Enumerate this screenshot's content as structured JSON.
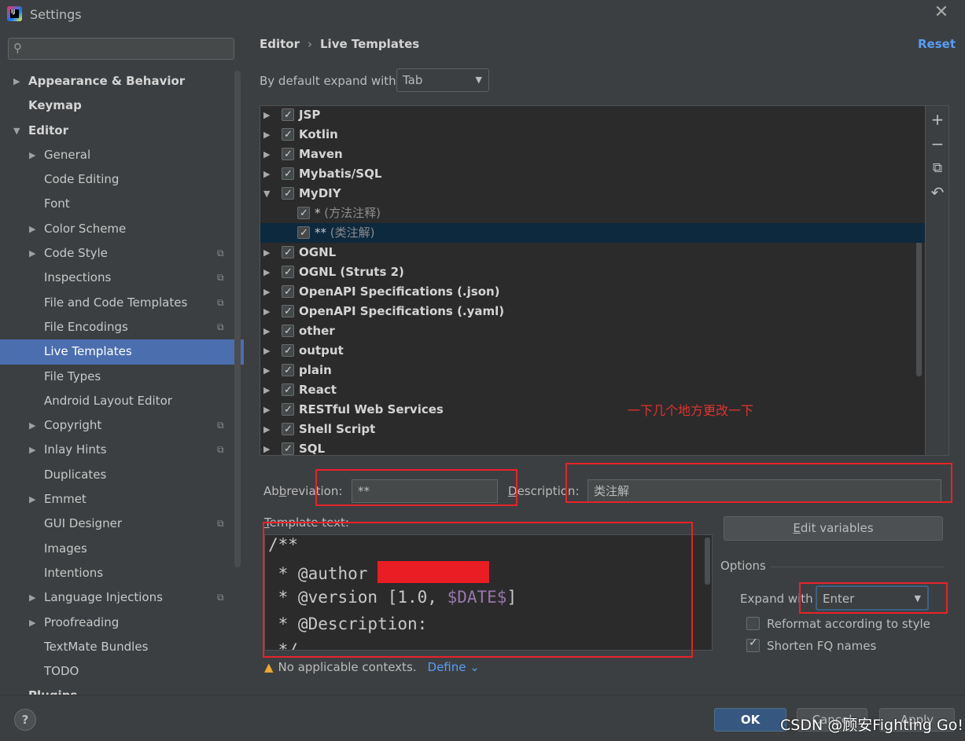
{
  "window": {
    "title": "Settings"
  },
  "search": {
    "placeholder": ""
  },
  "sidebar": {
    "items": [
      {
        "label": "Appearance & Behavior",
        "level": 0,
        "arrow": "▶",
        "copy": false
      },
      {
        "label": "Keymap",
        "level": 0,
        "arrow": "",
        "copy": false
      },
      {
        "label": "Editor",
        "level": 0,
        "arrow": "▼",
        "copy": false
      },
      {
        "label": "General",
        "level": 1,
        "arrow": "▶",
        "copy": false
      },
      {
        "label": "Code Editing",
        "level": 1,
        "arrow": "",
        "copy": false
      },
      {
        "label": "Font",
        "level": 1,
        "arrow": "",
        "copy": false
      },
      {
        "label": "Color Scheme",
        "level": 1,
        "arrow": "▶",
        "copy": false
      },
      {
        "label": "Code Style",
        "level": 1,
        "arrow": "▶",
        "copy": true
      },
      {
        "label": "Inspections",
        "level": 1,
        "arrow": "",
        "copy": true
      },
      {
        "label": "File and Code Templates",
        "level": 1,
        "arrow": "",
        "copy": true
      },
      {
        "label": "File Encodings",
        "level": 1,
        "arrow": "",
        "copy": true
      },
      {
        "label": "Live Templates",
        "level": 1,
        "arrow": "",
        "copy": false,
        "selected": true
      },
      {
        "label": "File Types",
        "level": 1,
        "arrow": "",
        "copy": false
      },
      {
        "label": "Android Layout Editor",
        "level": 1,
        "arrow": "",
        "copy": false
      },
      {
        "label": "Copyright",
        "level": 1,
        "arrow": "▶",
        "copy": true
      },
      {
        "label": "Inlay Hints",
        "level": 1,
        "arrow": "▶",
        "copy": true
      },
      {
        "label": "Duplicates",
        "level": 1,
        "arrow": "",
        "copy": false
      },
      {
        "label": "Emmet",
        "level": 1,
        "arrow": "▶",
        "copy": false
      },
      {
        "label": "GUI Designer",
        "level": 1,
        "arrow": "",
        "copy": true
      },
      {
        "label": "Images",
        "level": 1,
        "arrow": "",
        "copy": false
      },
      {
        "label": "Intentions",
        "level": 1,
        "arrow": "",
        "copy": false
      },
      {
        "label": "Language Injections",
        "level": 1,
        "arrow": "▶",
        "copy": true
      },
      {
        "label": "Proofreading",
        "level": 1,
        "arrow": "▶",
        "copy": false
      },
      {
        "label": "TextMate Bundles",
        "level": 1,
        "arrow": "",
        "copy": false
      },
      {
        "label": "TODO",
        "level": 1,
        "arrow": "",
        "copy": false
      },
      {
        "label": "Plugins",
        "level": 0,
        "arrow": "",
        "copy": false
      }
    ]
  },
  "breadcrumb": {
    "parent": "Editor",
    "separator": "›",
    "current": "Live Templates"
  },
  "reset_label": "Reset",
  "default_expand": {
    "label": "By default expand with",
    "value": "Tab"
  },
  "templates": [
    {
      "name": "JSP",
      "type": "group",
      "arrow": "▶"
    },
    {
      "name": "Kotlin",
      "type": "group",
      "arrow": "▶"
    },
    {
      "name": "Maven",
      "type": "group",
      "arrow": "▶"
    },
    {
      "name": "Mybatis/SQL",
      "type": "group",
      "arrow": "▶"
    },
    {
      "name": "MyDIY",
      "type": "group",
      "arrow": "▼"
    },
    {
      "name": "*",
      "desc": " (方法注释)",
      "type": "child"
    },
    {
      "name": "**",
      "desc": " (类注解)",
      "type": "child",
      "selected": true
    },
    {
      "name": "OGNL",
      "type": "group",
      "arrow": "▶"
    },
    {
      "name": "OGNL (Struts 2)",
      "type": "group",
      "arrow": "▶"
    },
    {
      "name": "OpenAPI Specifications (.json)",
      "type": "group",
      "arrow": "▶"
    },
    {
      "name": "OpenAPI Specifications (.yaml)",
      "type": "group",
      "arrow": "▶"
    },
    {
      "name": "other",
      "type": "group",
      "arrow": "▶"
    },
    {
      "name": "output",
      "type": "group",
      "arrow": "▶"
    },
    {
      "name": "plain",
      "type": "group",
      "arrow": "▶"
    },
    {
      "name": "React",
      "type": "group",
      "arrow": "▶"
    },
    {
      "name": "RESTful Web Services",
      "type": "group",
      "arrow": "▶"
    },
    {
      "name": "Shell Script",
      "type": "group",
      "arrow": "▶"
    },
    {
      "name": "SQL",
      "type": "group",
      "arrow": "▶"
    }
  ],
  "toolbar": {
    "add": "+",
    "remove": "−",
    "copy": "⧉",
    "revert": "↶"
  },
  "annotation": "一下几个地方更改一下",
  "abbreviation": {
    "label_pre": "Ab",
    "label_u": "b",
    "label_post": "reviation:",
    "value": "**"
  },
  "description": {
    "label_u": "D",
    "label_post": "escription:",
    "value": "类注解"
  },
  "template_text": {
    "label_u": "T",
    "label_post": "emplate text:",
    "lines": [
      "/**",
      " * @author ",
      " * @version [1.0, ",
      "$DATE$",
      "]",
      " * @Description:",
      " */"
    ]
  },
  "edit_variables": {
    "label_u": "E",
    "label_post": "dit variables"
  },
  "options": {
    "title": "Options",
    "expand_label": "Expand with",
    "expand_value": "Enter",
    "reformat_label": "Reformat according to style",
    "reformat_checked": false,
    "shorten_label": "Shorten FQ names",
    "shorten_checked": true
  },
  "contexts": {
    "warning": "No applicable contexts.",
    "define": "Define"
  },
  "buttons": {
    "help": "?",
    "ok": "OK",
    "cancel": "Cancel",
    "apply": "Apply"
  },
  "watermark": "CSDN @顾安Fighting Go!"
}
